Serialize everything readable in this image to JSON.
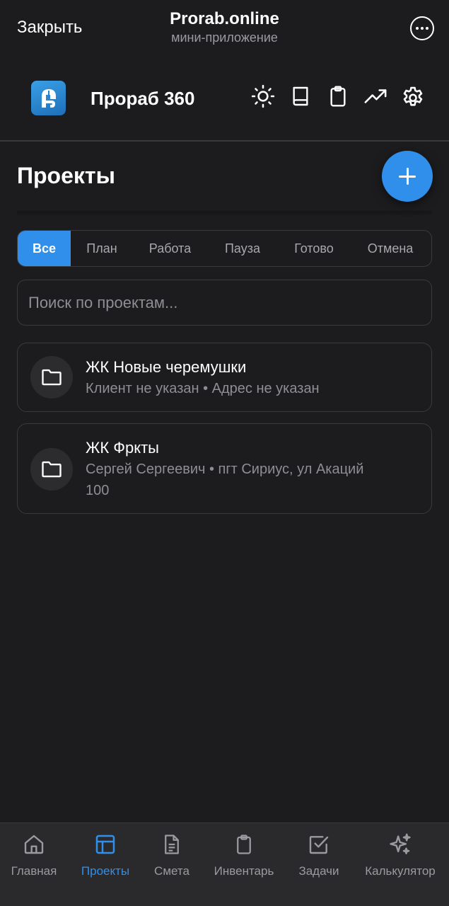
{
  "topbar": {
    "close_label": "Закрыть",
    "title": "Prorab.online",
    "subtitle": "мини-приложение",
    "more_icon": "more-dots-icon"
  },
  "header": {
    "brand": "Прораб 360",
    "logo": "prorab-logo-icon",
    "icons": [
      "sun-icon",
      "book-icon",
      "clipboard-icon",
      "trending-up-icon",
      "gear-icon"
    ]
  },
  "projects": {
    "title": "Проекты",
    "add_icon": "plus-icon",
    "filters": [
      "Все",
      "План",
      "Работа",
      "Пауза",
      "Готово",
      "Отмена"
    ],
    "active_filter": "Все",
    "search_placeholder": "Поиск по проектам...",
    "items": [
      {
        "title": "ЖК Новые черемушки",
        "subtitle": "Клиент не указан • Адрес не указан",
        "icon": "folder-icon"
      },
      {
        "title": "ЖК Фркты",
        "subtitle": "Сергей Сергеевич • пгт Сириус, ул Акаций 100",
        "icon": "folder-icon"
      }
    ]
  },
  "nav": {
    "items": [
      {
        "label": "Главная",
        "icon": "home-icon"
      },
      {
        "label": "Проекты",
        "icon": "layout-icon"
      },
      {
        "label": "Смета",
        "icon": "document-icon"
      },
      {
        "label": "Инвентарь",
        "icon": "clipboard-icon"
      },
      {
        "label": "Задачи",
        "icon": "checkbox-icon"
      },
      {
        "label": "Калькулятор",
        "icon": "sparkles-icon"
      }
    ],
    "active": "Проекты"
  },
  "colors": {
    "background": "#1c1c1e",
    "accent": "#2f8fea",
    "border": "#3a3a3c",
    "muted_text": "#8e8e93"
  }
}
